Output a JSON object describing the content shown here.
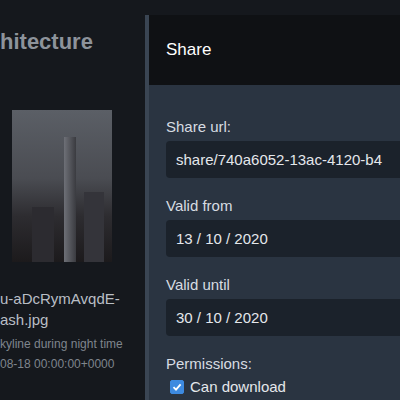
{
  "page": {
    "title": "hitecture"
  },
  "item": {
    "file_name": [
      "u-aDcRymAvqdE-",
      "ash.jpg"
    ],
    "description": "kyline during night time",
    "date": "08-18 00:00:00+0000"
  },
  "modal": {
    "title": "Share",
    "fields": [
      {
        "label": "Share url:",
        "value": "share/740a6052-13ac-4120-b4"
      },
      {
        "label": "Valid from",
        "value": "13 / 10 / 2020"
      },
      {
        "label": "Valid until",
        "value": "30 / 10 / 2020"
      }
    ],
    "permissions_label": "Permissions:",
    "permissions": [
      {
        "label": "Can download",
        "checked": true
      }
    ]
  }
}
